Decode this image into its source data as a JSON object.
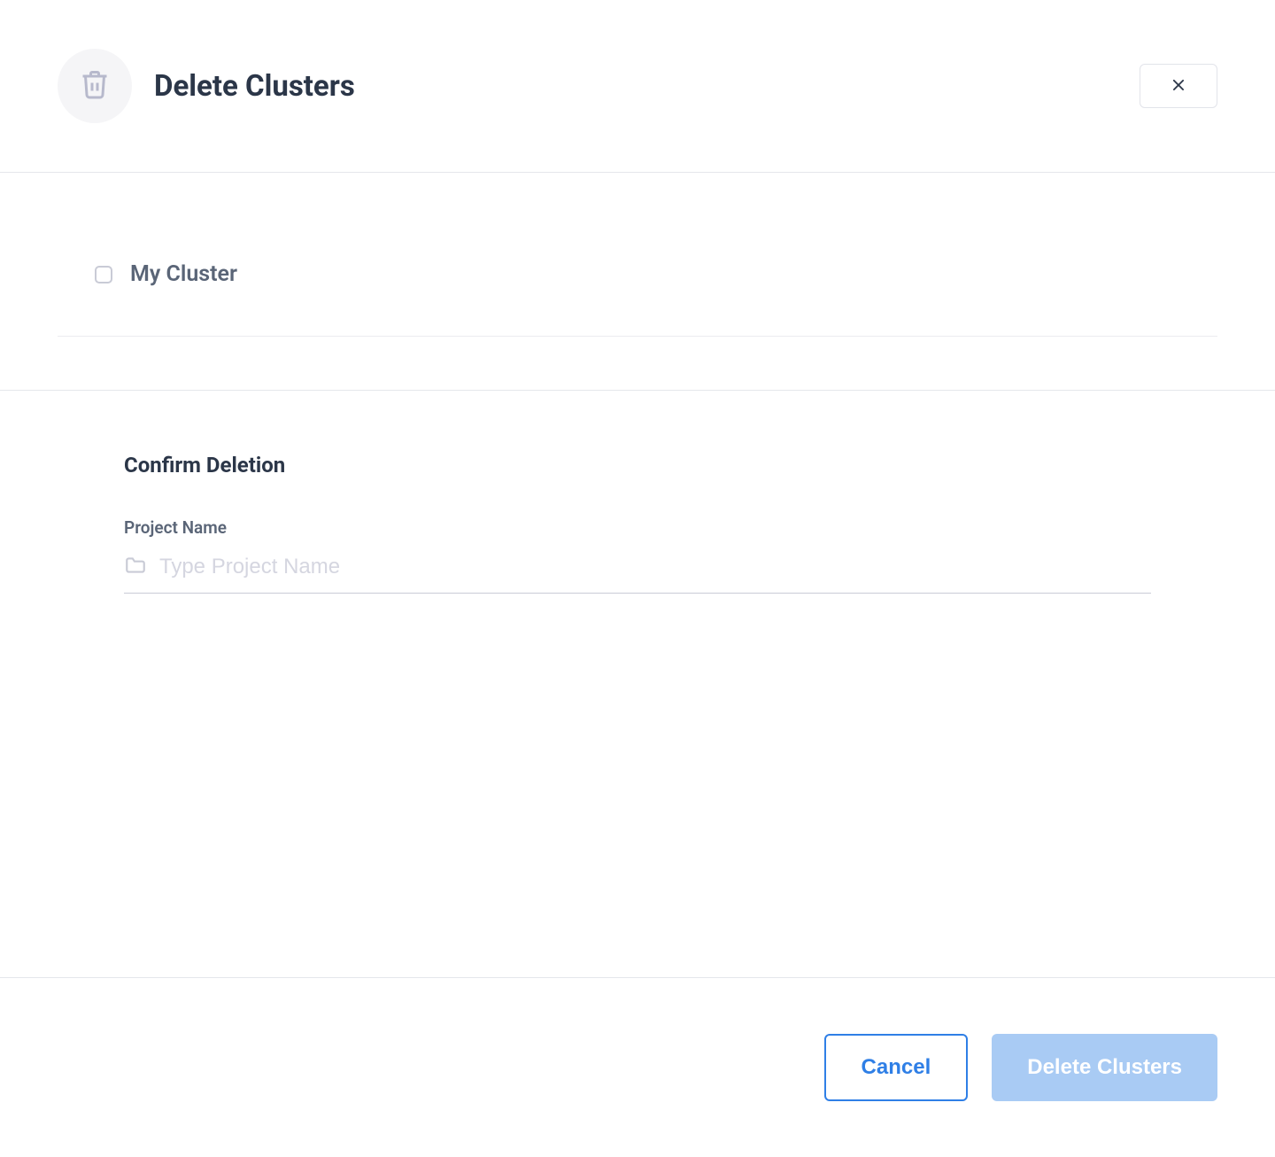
{
  "header": {
    "title": "Delete Clusters"
  },
  "clusters": {
    "items": [
      {
        "label": "My Cluster",
        "checked": false
      }
    ]
  },
  "confirm": {
    "heading": "Confirm Deletion",
    "field_label": "Project Name",
    "placeholder": "Type Project Name",
    "value": ""
  },
  "footer": {
    "cancel_label": "Cancel",
    "delete_label": "Delete Clusters"
  }
}
